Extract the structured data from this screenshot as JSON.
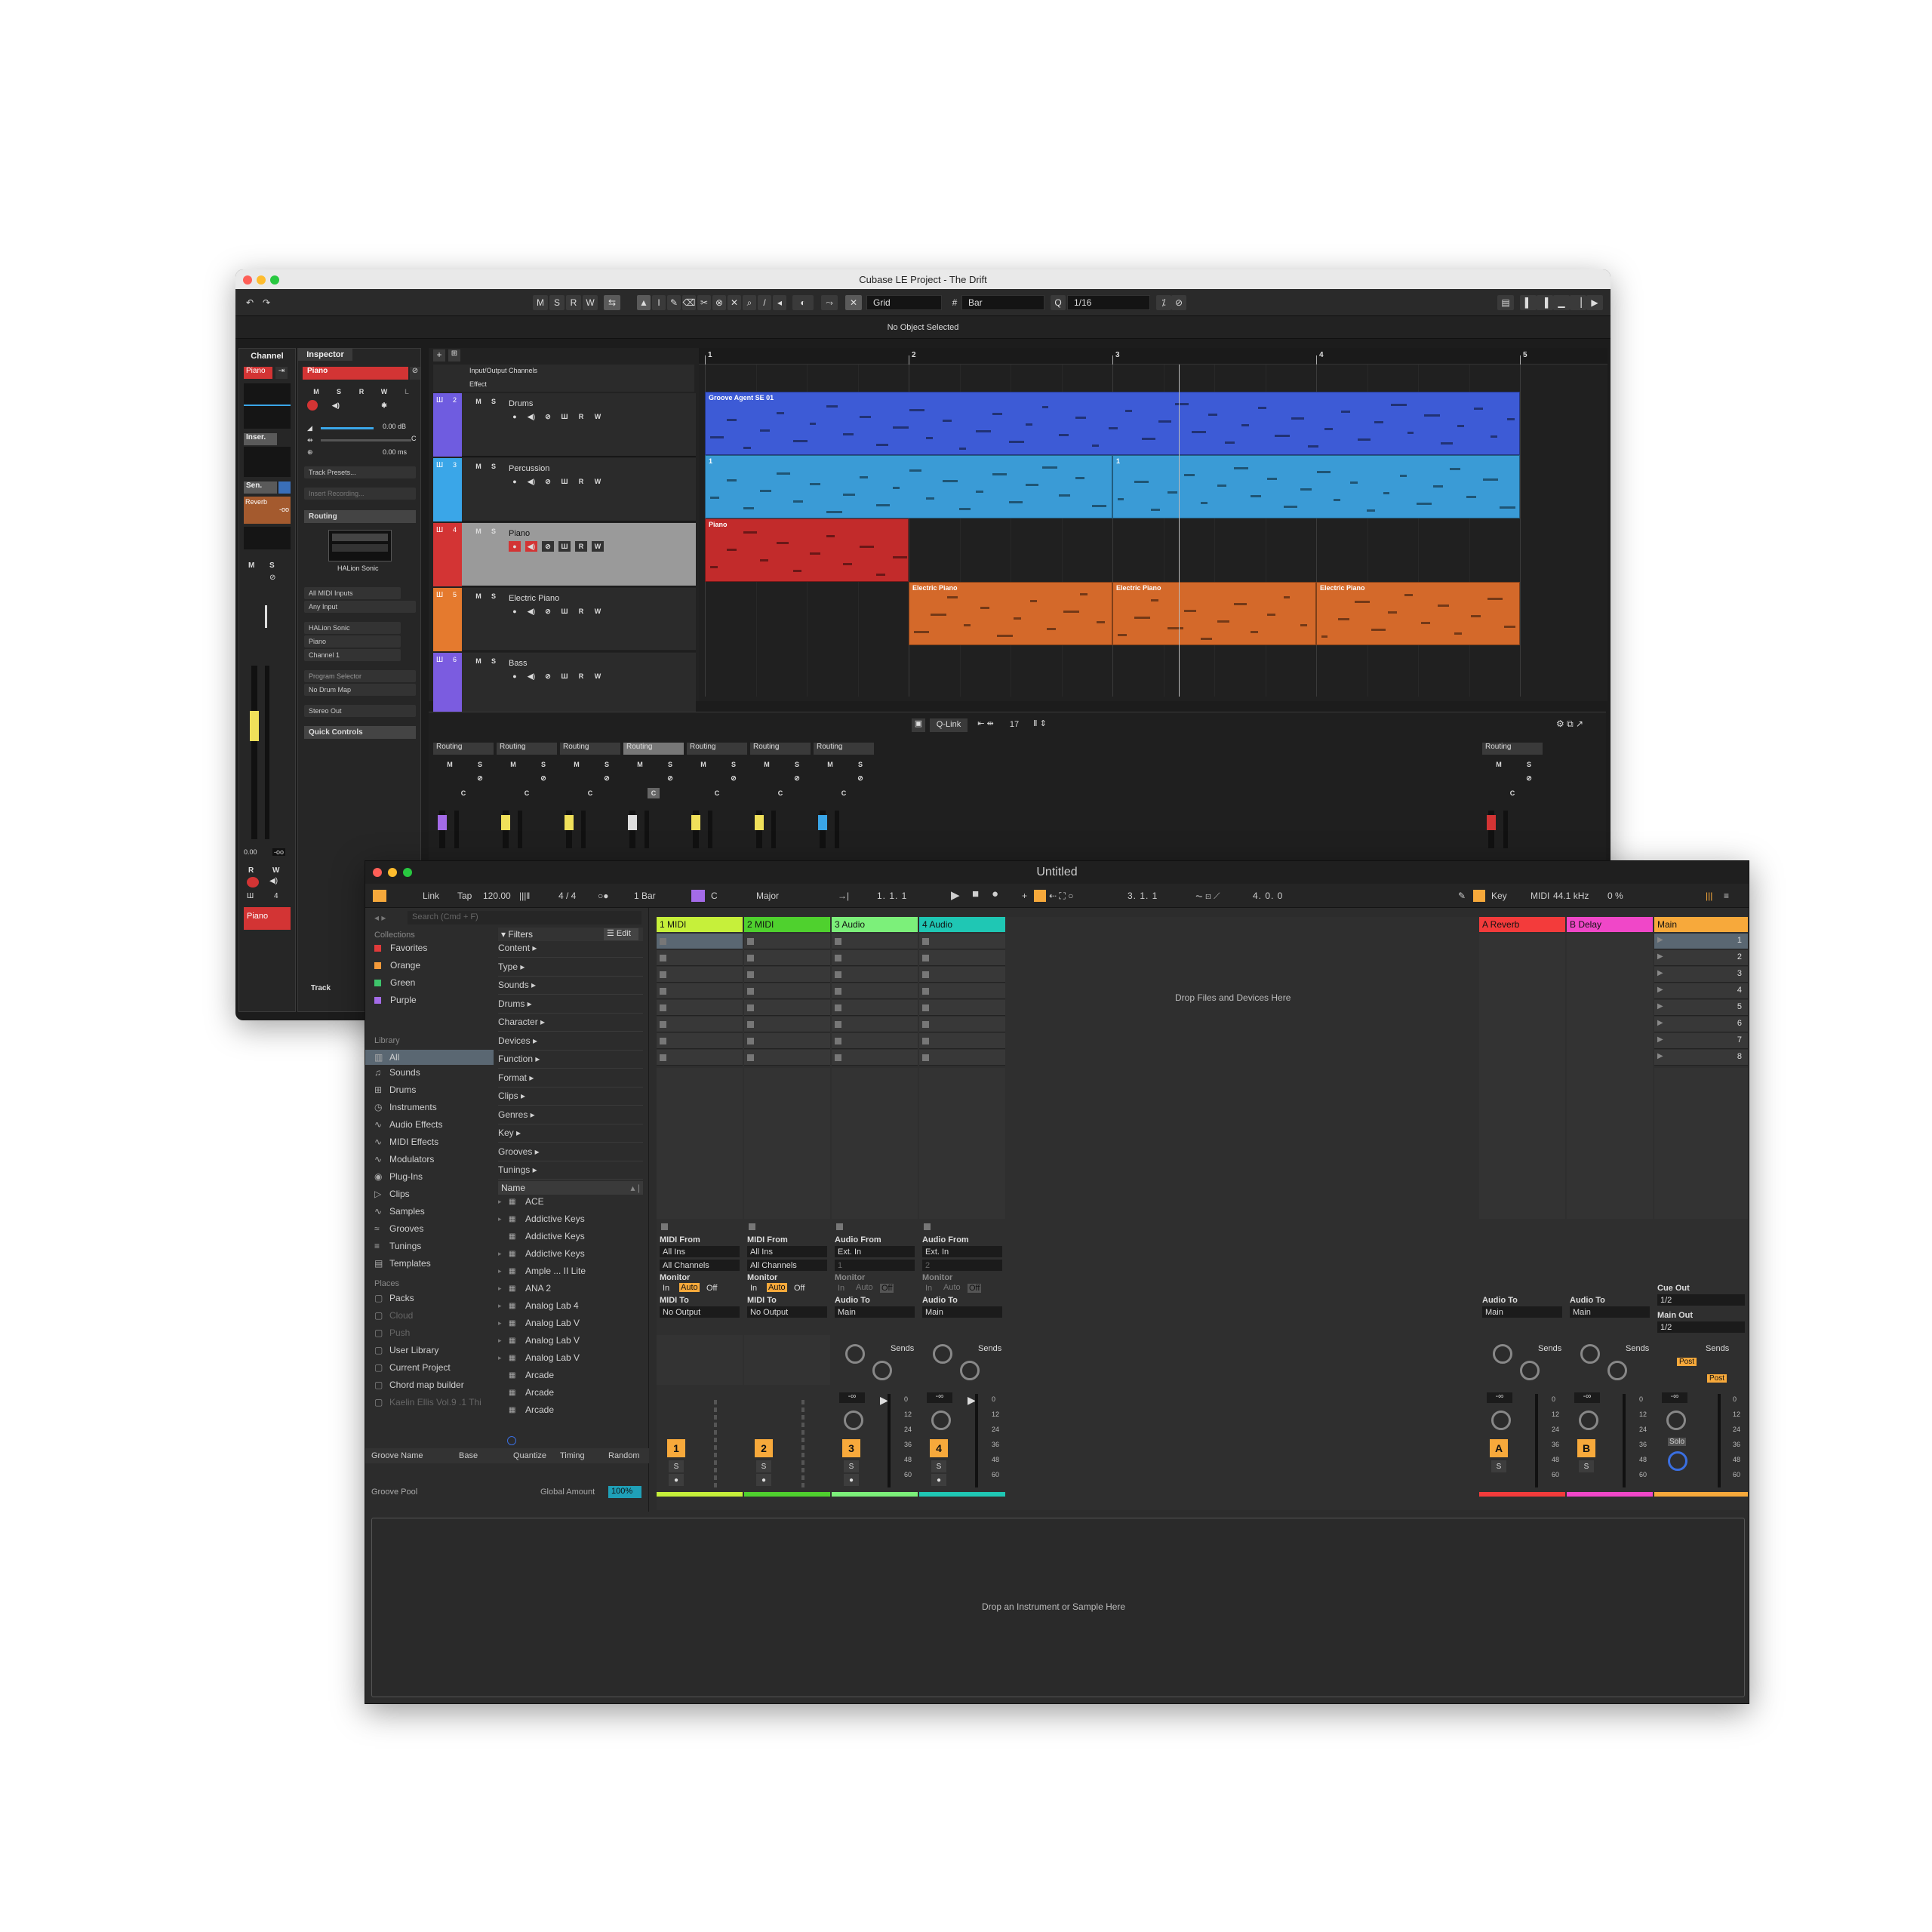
{
  "cubase": {
    "title": "Cubase LE Project - The Drift",
    "info": "No Object Selected",
    "toolbar": {
      "msrw": [
        "M",
        "S",
        "R",
        "W"
      ],
      "snap_mode": "Grid",
      "snap_type": "Bar",
      "quantize": "1/16"
    },
    "left_tabs": {
      "channel": "Channel",
      "inspector": "Inspector"
    },
    "channel": {
      "name": "Piano",
      "insert": "Inser.",
      "send": "Sen.",
      "send_fx": "Reverb",
      "send_val": "-oo",
      "fader_val": "0.00",
      "fader_val2": "-oo",
      "bottom_name": "Piano",
      "ch_num": "4"
    },
    "inspector": {
      "track_name": "Piano",
      "volume": "0.00 dB",
      "pan": "C",
      "delay": "0.00 ms",
      "presets": "Track Presets...",
      "insert_rec": "Insert Recording...",
      "routing": "Routing",
      "instrument": "HALion Sonic",
      "midi_in": "All MIDI Inputs",
      "any_input": "Any Input",
      "out_inst": "HALion Sonic",
      "out_prog": "Piano",
      "channel": "Channel 1",
      "prog_sel": "Program Selector",
      "drum_map": "No Drum Map",
      "stereo_out": "Stereo Out",
      "quick_controls": "Quick Controls",
      "track_tab": "Track"
    },
    "folders": [
      "Input/Output Channels",
      "Effect"
    ],
    "tracks": [
      {
        "num": "2",
        "name": "Drums",
        "color": "#6f5ce0"
      },
      {
        "num": "3",
        "name": "Percussion",
        "color": "#3aa6e8"
      },
      {
        "num": "4",
        "name": "Piano",
        "color": "#d33434"
      },
      {
        "num": "5",
        "name": "Electric Piano",
        "color": "#e57a2e"
      },
      {
        "num": "6",
        "name": "Bass",
        "color": "#7b5ce0"
      }
    ],
    "ruler": [
      "1",
      "2",
      "3",
      "4",
      "5"
    ],
    "parts": {
      "drums": "Groove Agent SE 01",
      "perc1": "1",
      "perc2": "1",
      "piano": "Piano",
      "ep1": "Electric Piano",
      "ep2": "Electric Piano",
      "ep3": "Electric Piano"
    },
    "lower": {
      "qlink": "Q-Link",
      "count": "17",
      "routing": "Routing",
      "ms": [
        "M",
        "S"
      ],
      "pan": "C"
    }
  },
  "ableton": {
    "title": "Untitled",
    "control": {
      "link": "Link",
      "tap": "Tap",
      "tempo": "120.00",
      "sig": "4 / 4",
      "quant": "1 Bar",
      "key": "C",
      "scale": "Major",
      "pos1": "1.   1.   1",
      "pos2": "3.   1.   1",
      "pos3": "4.   0.   0",
      "key_btn": "Key",
      "midi": "MIDI",
      "rate": "44.1 kHz",
      "cpu": "0 %"
    },
    "search": "Search (Cmd + F)",
    "collections_hdr": "Collections",
    "collections": [
      {
        "name": "Favorites",
        "color": "#e03a3a"
      },
      {
        "name": "Orange",
        "color": "#f39a3a"
      },
      {
        "name": "Green",
        "color": "#3ec46b"
      },
      {
        "name": "Purple",
        "color": "#a46be8"
      }
    ],
    "library_hdr": "Library",
    "library": [
      "All",
      "Sounds",
      "Drums",
      "Instruments",
      "Audio Effects",
      "MIDI Effects",
      "Modulators",
      "Plug-Ins",
      "Clips",
      "Samples",
      "Grooves",
      "Tunings",
      "Templates"
    ],
    "places_hdr": "Places",
    "places": [
      "Packs",
      "Cloud",
      "Push",
      "User Library",
      "Current Project",
      "Chord map builder",
      "Kaelin Ellis Vol.9 .1 Thi"
    ],
    "filters_hdr": "Filters",
    "edit": "Edit",
    "filters": [
      "Content ▸",
      "Type ▸",
      "Sounds ▸",
      "Drums ▸",
      "Character ▸",
      "Devices ▸",
      "Function ▸",
      "Format ▸",
      "Clips ▸",
      "Genres ▸",
      "Key ▸",
      "Grooves ▸",
      "Tunings ▸"
    ],
    "name_hdr": "Name",
    "results": [
      "ACE",
      "Addictive Keys",
      "Addictive Keys",
      "Addictive Keys",
      "Ample ... II Lite",
      "ANA 2",
      "Analog Lab 4",
      "Analog Lab V",
      "Analog Lab V",
      "Analog Lab V",
      "Arcade",
      "Arcade",
      "Arcade"
    ],
    "groove": {
      "name": "Groove Name",
      "base": "Base",
      "quantize": "Quantize",
      "timing": "Timing",
      "random": "Random",
      "pool": "Groove Pool",
      "global": "Global Amount",
      "amount": "100%"
    },
    "tracks": [
      {
        "name": "1 MIDI",
        "color": "#c6f03a",
        "num": "1",
        "from_lbl": "MIDI From",
        "from": "All Ins",
        "ch": "All Channels",
        "to_lbl": "MIDI To",
        "to": "No Output"
      },
      {
        "name": "2 MIDI",
        "color": "#4fd12e",
        "num": "2",
        "from_lbl": "MIDI From",
        "from": "All Ins",
        "ch": "All Channels",
        "to_lbl": "MIDI To",
        "to": "No Output"
      },
      {
        "name": "3 Audio",
        "color": "#7cf07a",
        "num": "3",
        "from_lbl": "Audio From",
        "from": "Ext. In",
        "ch": "1",
        "to_lbl": "Audio To",
        "to": "Main"
      },
      {
        "name": "4 Audio",
        "color": "#1fc7b4",
        "num": "4",
        "from_lbl": "Audio From",
        "from": "Ext. In",
        "ch": "2",
        "to_lbl": "Audio To",
        "to": "Main"
      }
    ],
    "returns": [
      {
        "name": "A Reverb",
        "color": "#f33b3b",
        "num": "A",
        "to_lbl": "Audio To",
        "to": "Main"
      },
      {
        "name": "B Delay",
        "color": "#f047c8",
        "num": "B",
        "to_lbl": "Audio To",
        "to": "Main"
      }
    ],
    "main": {
      "name": "Main",
      "color": "#f7a93b",
      "cue_lbl": "Cue Out",
      "cue": "1/2",
      "out_lbl": "Main Out",
      "out": "1/2",
      "post": "Post",
      "solo": "Solo"
    },
    "scenes": [
      "1",
      "2",
      "3",
      "4",
      "5",
      "6",
      "7",
      "8"
    ],
    "monitor": {
      "lbl": "Monitor",
      "in": "In",
      "auto": "Auto",
      "off": "Off"
    },
    "sends": "Sends",
    "minf": "-∞",
    "db_scale": [
      "0",
      "12",
      "24",
      "36",
      "48",
      "60"
    ],
    "drop_files": "Drop Files and Devices Here",
    "drop_inst": "Drop an Instrument or Sample Here"
  }
}
